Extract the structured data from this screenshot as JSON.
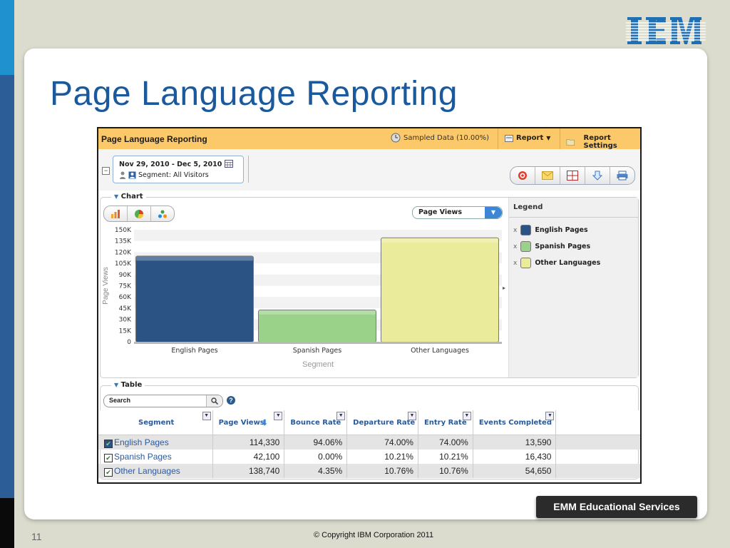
{
  "slide": {
    "title": "Page Language Reporting",
    "page_number": "11",
    "copyright": "© Copyright IBM Corporation 2011",
    "badge": "EMM Educational Services",
    "logo": "IBM"
  },
  "app": {
    "title": "Page Language Reporting",
    "sampled": "Sampled Data (10.00%)",
    "report_label": "Report",
    "report_settings_label": "Report Settings",
    "date_range": "Nov 29, 2010 - Dec 5, 2010",
    "segment": "Segment: All Visitors",
    "toolbar_icons": [
      "target-icon",
      "email-icon",
      "grid-icon",
      "download-icon",
      "print-icon"
    ]
  },
  "chart_section": {
    "label": "Chart",
    "metric": "Page Views",
    "legend_title": "Legend",
    "legend": [
      {
        "label": "English Pages",
        "color": "#2b5484"
      },
      {
        "label": "Spanish Pages",
        "color": "#9bd28a"
      },
      {
        "label": "Other Languages",
        "color": "#ebeb9c"
      }
    ]
  },
  "chart_data": {
    "type": "bar",
    "categories": [
      "English Pages",
      "Spanish Pages",
      "Other Languages"
    ],
    "values": [
      114330,
      42100,
      138740
    ],
    "colors": [
      "#2b5484",
      "#9bd28a",
      "#ebeb9c"
    ],
    "xlabel": "Segment",
    "ylabel": "Page Views",
    "ylim": [
      0,
      150000
    ],
    "yticks": [
      "0",
      "15K",
      "30K",
      "45K",
      "60K",
      "75K",
      "90K",
      "105K",
      "120K",
      "135K",
      "150K"
    ],
    "grid": true
  },
  "table_section": {
    "label": "Table",
    "search_placeholder": "Search",
    "columns": [
      "Segment",
      "Page Views",
      "Bounce Rate",
      "Departure Rate",
      "Entry Rate",
      "Events Completed"
    ],
    "rows": [
      {
        "segment": "English Pages",
        "page_views": "114,330",
        "bounce": "94.06%",
        "departure": "74.00%",
        "entry": "74.00%",
        "events": "13,590"
      },
      {
        "segment": "Spanish Pages",
        "page_views": "42,100",
        "bounce": "0.00%",
        "departure": "10.21%",
        "entry": "10.21%",
        "events": "16,430"
      },
      {
        "segment": "Other Languages",
        "page_views": "138,740",
        "bounce": "4.35%",
        "departure": "10.76%",
        "entry": "10.76%",
        "events": "54,650"
      }
    ]
  }
}
